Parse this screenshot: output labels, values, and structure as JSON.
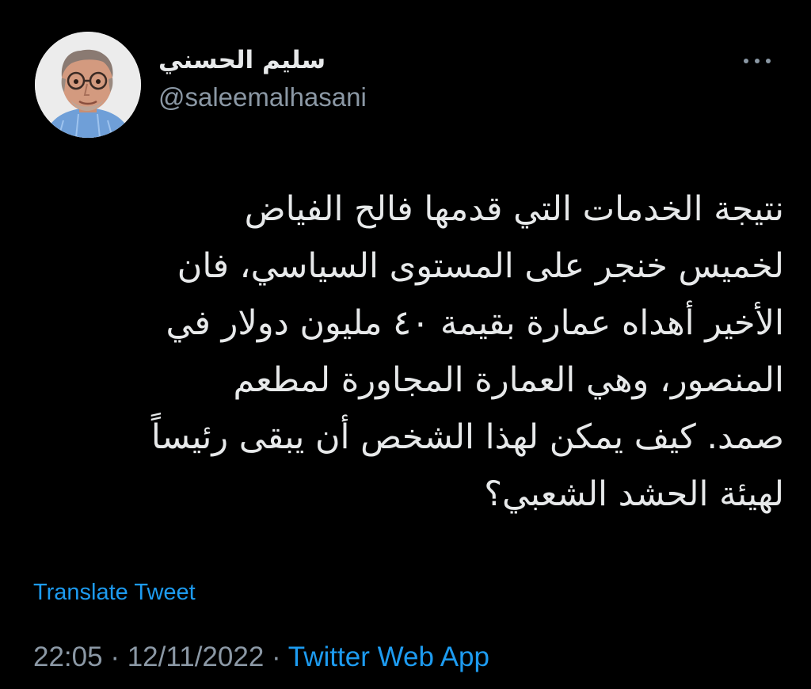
{
  "author": {
    "name": "سليم الحسني",
    "handle": "@saleemalhasani"
  },
  "tweet": {
    "lines": [
      "نتيجة الخدمات التي قدمها فالح الفياض",
      "لخميس خنجر على المستوى السياسي، فان",
      "الأخير أهداه عمارة بقيمة ٤٠ مليون دولار في",
      "المنصور، وهي العمارة المجاورة لمطعم",
      "صمد. كيف يمكن لهذا الشخص أن يبقى رئيساً",
      "لهيئة الحشد الشعبي؟"
    ]
  },
  "translate_label": "Translate Tweet",
  "meta": {
    "time": "22:05",
    "separator": "·",
    "date": "12/11/2022",
    "source": "Twitter Web App"
  },
  "icons": {
    "more": "more-horizontal-icon",
    "avatar": "avatar-photo"
  },
  "colors": {
    "background": "#000000",
    "text": "#e7e9ea",
    "muted": "#8b98a5",
    "link": "#1d9bf0"
  }
}
